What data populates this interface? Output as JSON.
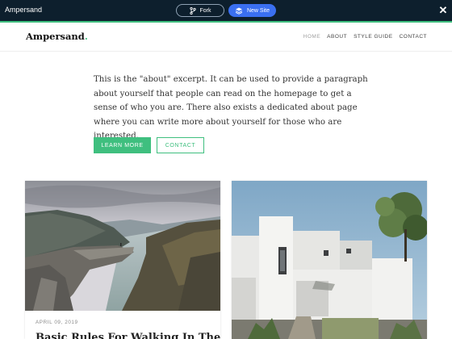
{
  "topbar": {
    "title": "Ampersand",
    "fork_label": "Fork",
    "new_site_label": "New Site",
    "close_symbol": "✕",
    "accent_color": "#3fbf7f",
    "background": "#0d1f2d",
    "fork_icon": "fork-icon",
    "new_site_icon": "rocket-icon"
  },
  "site": {
    "logo": "Ampersand",
    "logo_suffix": ".",
    "nav": [
      {
        "label": "HOME",
        "active": true
      },
      {
        "label": "ABOUT",
        "active": false
      },
      {
        "label": "STYLE GUIDE",
        "active": false
      },
      {
        "label": "CONTACT",
        "active": false
      }
    ]
  },
  "intro": {
    "text": "This is the \"about\" excerpt. It can be used to provide a paragraph about yourself that people can read on the homepage to get a sense of who you are. There also exists a dedicated about page where you can write more about yourself for those who are interested.",
    "learn_more": "LEARN MORE",
    "contact": "CONTACT",
    "accent_color": "#3fbf7f"
  },
  "posts": [
    {
      "date": "APRIL 09, 2019",
      "title": "Basic Rules For Walking In The",
      "image": "mountain-fjord-photo"
    },
    {
      "date": "",
      "title": "",
      "image": "white-modern-house-photo"
    }
  ]
}
